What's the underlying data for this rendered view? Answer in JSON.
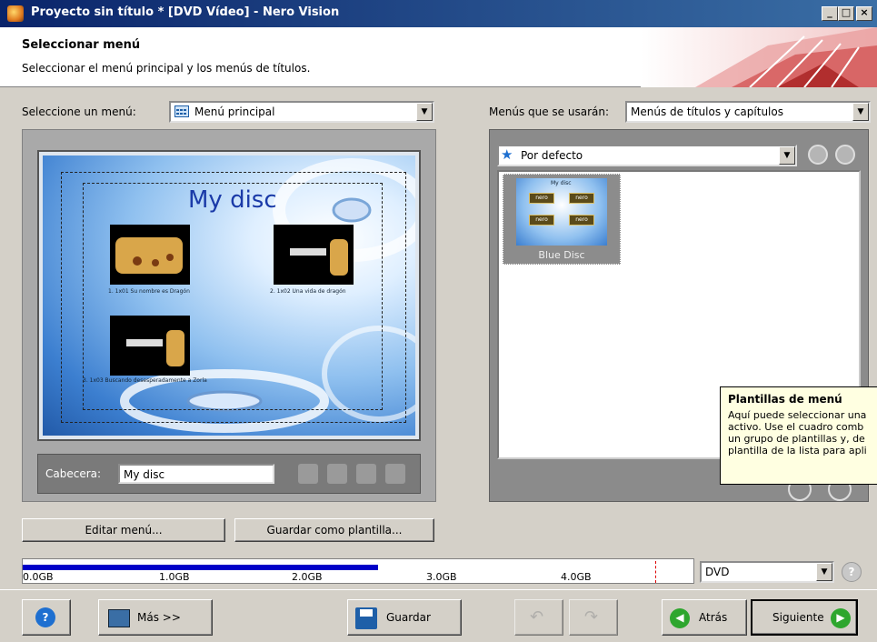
{
  "window": {
    "title": "Proyecto sin título * [DVD Vídeo] - Nero Vision",
    "min": "_",
    "max": "□",
    "close": "×"
  },
  "header": {
    "title": "Seleccionar menú",
    "subtitle": "Seleccionar el menú principal y los menús de títulos."
  },
  "left": {
    "select_label": "Seleccione un menú:",
    "select_value": "Menú principal",
    "preview": {
      "title": "My disc",
      "captions": [
        "1. 1x01 Su nombre es Dragón",
        "2. 1x02 Una vida de dragón",
        "3. 1x03 Buscando desesperadamente a Zorla"
      ]
    },
    "cabecera_label": "Cabecera:",
    "cabecera_value": "My disc",
    "edit_button": "Editar menú...",
    "save_template_button": "Guardar como plantilla..."
  },
  "right": {
    "menus_label": "Menús que se usarán:",
    "menus_value": "Menús de títulos y capítulos",
    "category_value": "Por defecto",
    "template_name": "Blue Disc",
    "template_mini_title": "My disc",
    "template_badges": [
      "nero",
      "nero",
      "nero",
      "nero"
    ]
  },
  "tooltip": {
    "title": "Plantillas de menú",
    "lines": [
      "Aquí puede seleccionar una",
      "activo. Use el cuadro comb",
      "un grupo de plantillas y, de",
      "plantilla de la lista para apli"
    ]
  },
  "capacity": {
    "ticks": [
      "0.0GB",
      "1.0GB",
      "2.0GB",
      "3.0GB",
      "4.0GB"
    ],
    "used_fraction": 0.53,
    "limit_gb": 4.7,
    "disc_type": "DVD",
    "fill_color": "#0000c8"
  },
  "footer": {
    "mas": "Más >>",
    "guardar": "Guardar",
    "atras": "Atrás",
    "siguiente": "Siguiente"
  },
  "icons": [
    "app-icon",
    "help-icon",
    "more-icon",
    "save-icon",
    "undo-icon",
    "redo-icon",
    "back-arrow-icon",
    "next-arrow-icon",
    "star-icon",
    "menu-grid-icon"
  ]
}
